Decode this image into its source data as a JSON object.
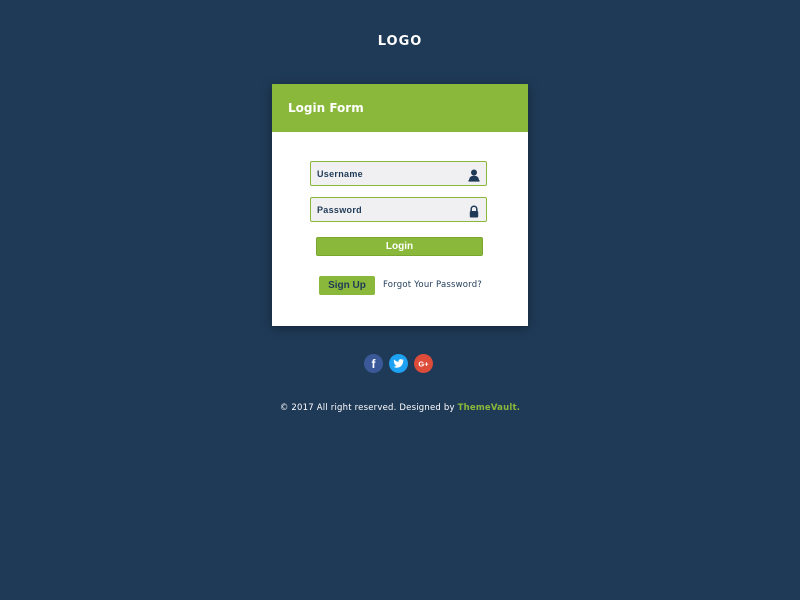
{
  "header": {
    "logo_text": "LOGO"
  },
  "login_form": {
    "title": "Login Form",
    "username": {
      "value": "",
      "placeholder": "Username",
      "icon": "user-icon"
    },
    "password": {
      "value": "",
      "placeholder": "Password",
      "icon": "lock-icon"
    },
    "login_label": "Login",
    "signup_label": "Sign Up",
    "forgot_label": "Forgot Your Password?"
  },
  "social": {
    "facebook_glyph": "f",
    "google_glyph": "G+"
  },
  "footer": {
    "copyright_text": "© 2017 All right reserved. Designed by ",
    "brand": "ThemeVault."
  },
  "colors": {
    "background": "#1f3a57",
    "accent": "#8ab83a",
    "facebook": "#3b5998",
    "twitter": "#1da1f2",
    "google_plus": "#dd4b39"
  }
}
